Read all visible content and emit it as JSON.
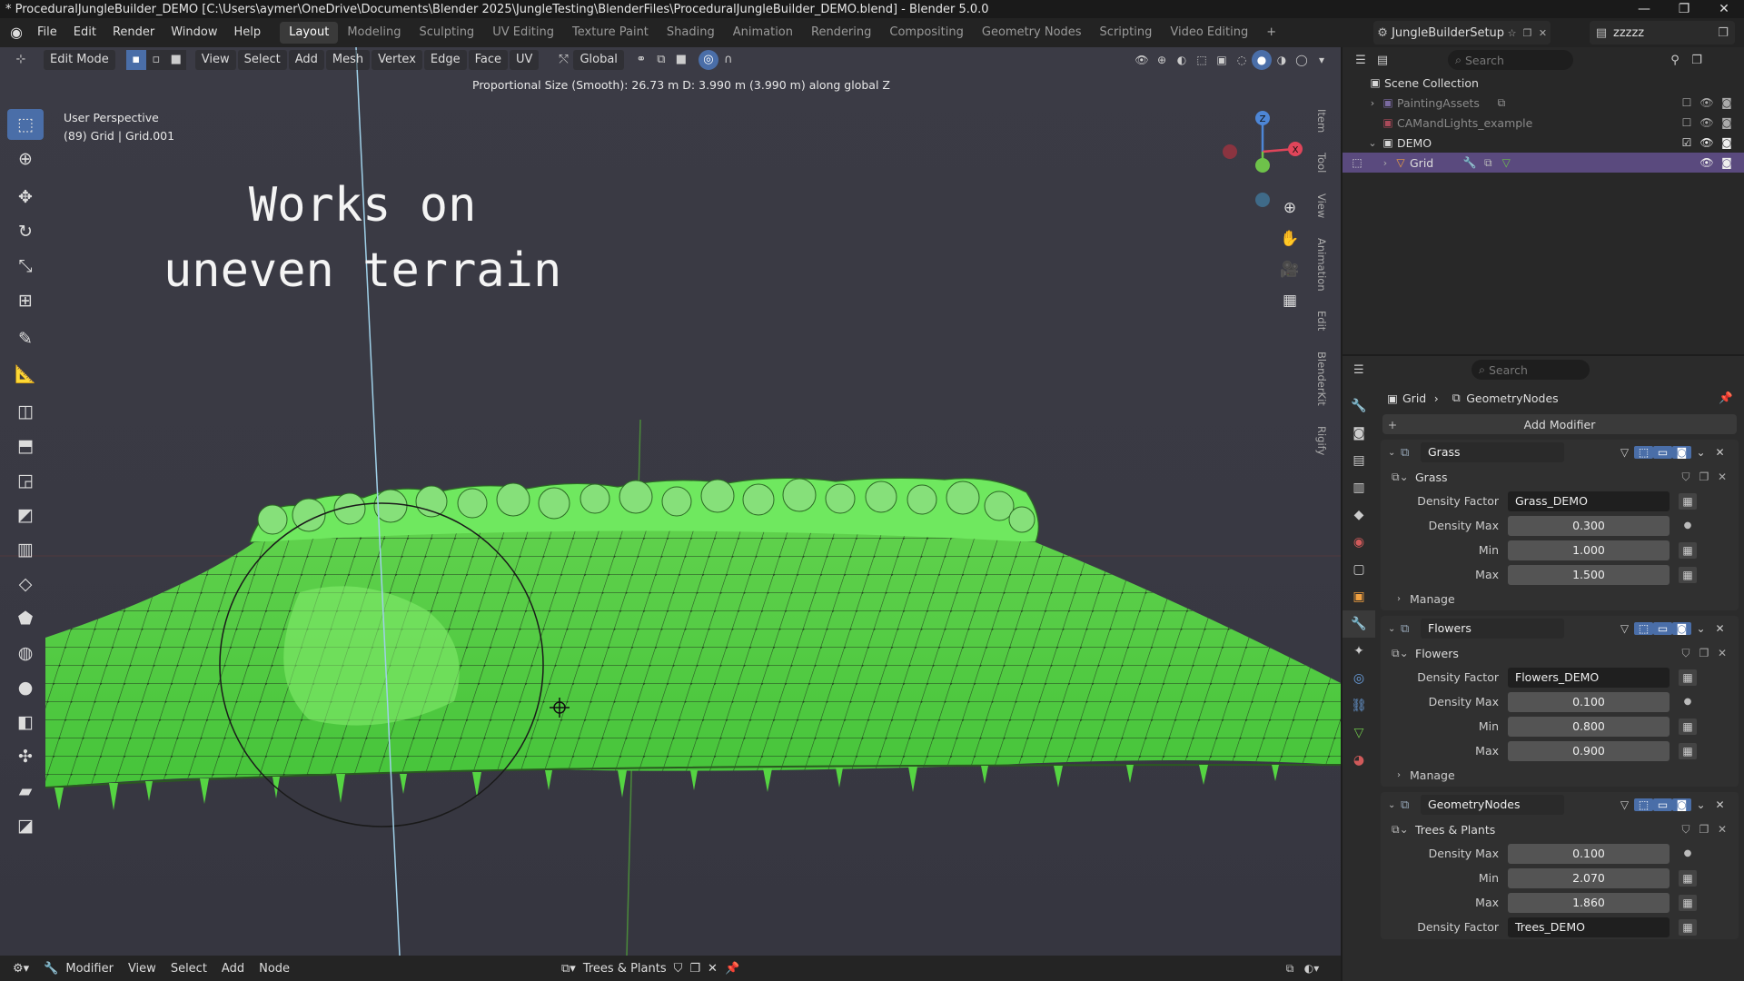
{
  "window": {
    "title": "* ProceduralJungleBuilder_DEMO [C:\\Users\\aymer\\OneDrive\\Documents\\Blender 2025\\JungleTesting\\BlenderFiles\\ProceduralJungleBuilder_DEMO.blend] - Blender 5.0.0",
    "minimize": "—",
    "maximize": "❐",
    "close": "✕"
  },
  "menu": {
    "items": [
      "File",
      "Edit",
      "Render",
      "Window",
      "Help"
    ],
    "workspaces": [
      "Layout",
      "Modeling",
      "Sculpting",
      "UV Editing",
      "Texture Paint",
      "Shading",
      "Animation",
      "Rendering",
      "Compositing",
      "Geometry Nodes",
      "Scripting",
      "Video Editing"
    ],
    "active_workspace": "Layout",
    "add_workspace": "+",
    "scene": "JungleBuilderSetup",
    "view_layer": "zzzzz"
  },
  "viewport": {
    "mode": "Edit Mode",
    "menus": [
      "View",
      "Select",
      "Add",
      "Mesh",
      "Vertex",
      "Edge",
      "Face",
      "UV"
    ],
    "transform_orientation": "Global",
    "status": "Proportional Size (Smooth): 26.73 m   D: 3.990 m (3.990 m) along global Z",
    "perspective": "User Perspective",
    "object_info": "(89) Grid | Grid.001",
    "overlay_line1": "Works on",
    "overlay_line2": "uneven terrain",
    "side_tabs": [
      "Item",
      "Tool",
      "View",
      "Animation",
      "Edit",
      "BlenderKit",
      "Rigify"
    ],
    "gizmo": {
      "z": "Z",
      "x": "X"
    }
  },
  "outliner": {
    "search_placeholder": "Search",
    "rows": [
      {
        "label": "Scene Collection",
        "dim": false
      },
      {
        "label": "PaintingAssets",
        "dim": true
      },
      {
        "label": "CAMandLights_example",
        "dim": true
      },
      {
        "label": "DEMO",
        "dim": false
      },
      {
        "label": "Grid",
        "dim": false,
        "selected": true
      }
    ]
  },
  "properties": {
    "search_placeholder": "Search",
    "breadcrumb_object": "Grid",
    "breadcrumb_modifier": "GeometryNodes",
    "add_modifier": "Add Modifier",
    "manage_label": "Manage",
    "modifiers": [
      {
        "name": "Grass",
        "group": "Grass",
        "density_factor_label": "Density Factor",
        "density_factor": "Grass_DEMO",
        "density_max_label": "Density Max",
        "density_max": "0.300",
        "min_label": "Min",
        "min": "1.000",
        "max_label": "Max",
        "max": "1.500"
      },
      {
        "name": "Flowers",
        "group": "Flowers",
        "density_factor_label": "Density Factor",
        "density_factor": "Flowers_DEMO",
        "density_max_label": "Density Max",
        "density_max": "0.100",
        "min_label": "Min",
        "min": "0.800",
        "max_label": "Max",
        "max": "0.900"
      },
      {
        "name": "GeometryNodes",
        "group": "Trees & Plants",
        "density_max_label": "Density Max",
        "density_max": "0.100",
        "min_label": "Min",
        "min": "2.070",
        "max_label": "Max",
        "max": "1.860",
        "density_factor_label": "Density Factor",
        "density_factor": "Trees_DEMO"
      }
    ]
  },
  "bottom": {
    "mode": "Modifier",
    "menus": [
      "View",
      "Select",
      "Add",
      "Node"
    ],
    "node_tree": "Trees & Plants"
  },
  "colors": {
    "accent": "#4a6ea8",
    "selection": "#5a4a7e",
    "grass": "#6ef25a",
    "axis_x": "#e0455a",
    "axis_y": "#6ec24a",
    "axis_z": "#4d86d6"
  }
}
